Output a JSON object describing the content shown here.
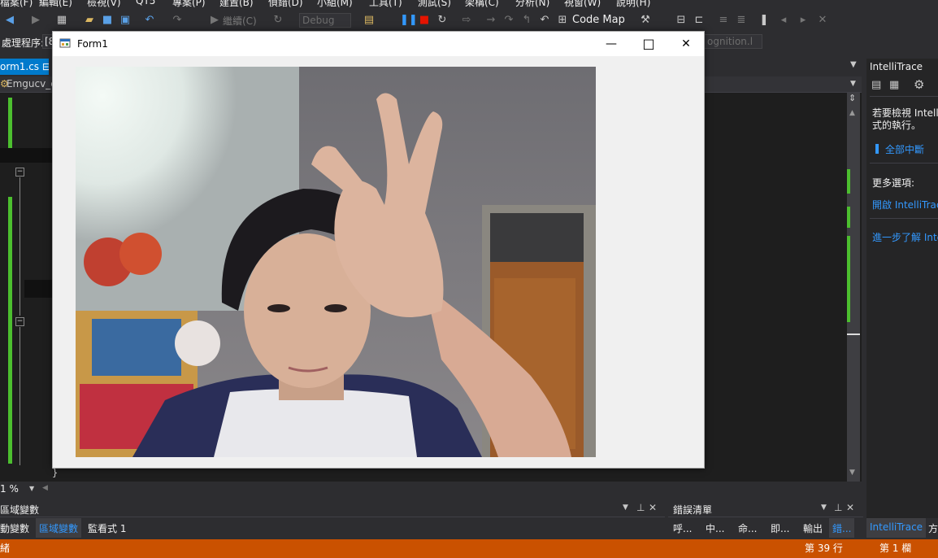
{
  "menu": [
    "檔案(F)",
    "編輯(E)",
    "檢視(V)",
    "QT5",
    "專案(P)",
    "建置(B)",
    "偵錯(D)",
    "小組(M)",
    "工具(T)",
    "測試(S)",
    "架構(C)",
    "分析(N)",
    "視窗(W)",
    "說明(H)"
  ],
  "toolbar": {
    "continue_label": "繼續(C)",
    "config_value": "Debug",
    "code_map_label": "Code Map"
  },
  "toolbar2": {
    "process_label": "處理程序:",
    "process_value": "[8",
    "stackframe_value": "ognition.l"
  },
  "document_tab": {
    "label": "orm1.cs"
  },
  "nav": {
    "project": "Emgucv_e"
  },
  "editor": {
    "zoom": "1 %",
    "brace": "}"
  },
  "form": {
    "title": "Form1",
    "minimize_glyph": "—",
    "maximize_glyph": "□",
    "close_glyph": "✕"
  },
  "intellitrace": {
    "title": "IntelliTrace",
    "description": "若要檢視 Intelli 式的執行。",
    "break_all": "全部中斷",
    "more_options": "更多選項:",
    "open_link": "開啟 IntelliTrac",
    "learn_more": "進一步了解 Inte"
  },
  "bottom_left": {
    "header": "區域變數",
    "tabs": [
      "動變數",
      "區域變數",
      "監看式 1"
    ]
  },
  "bottom_right": {
    "header": "錯誤清單",
    "tabs": [
      "呼...",
      "中...",
      "命...",
      "即...",
      "輸出",
      "錯..."
    ]
  },
  "bottom_far_right": {
    "tabs": [
      "IntelliTrace",
      "方"
    ]
  },
  "status": {
    "left": "緒",
    "line": "第 39 行",
    "col": "第 1 欄"
  },
  "colors": {
    "accent": "#007acc",
    "status": "#ca5100",
    "debug_stop": "#e51400",
    "pause": "#3399ff"
  }
}
